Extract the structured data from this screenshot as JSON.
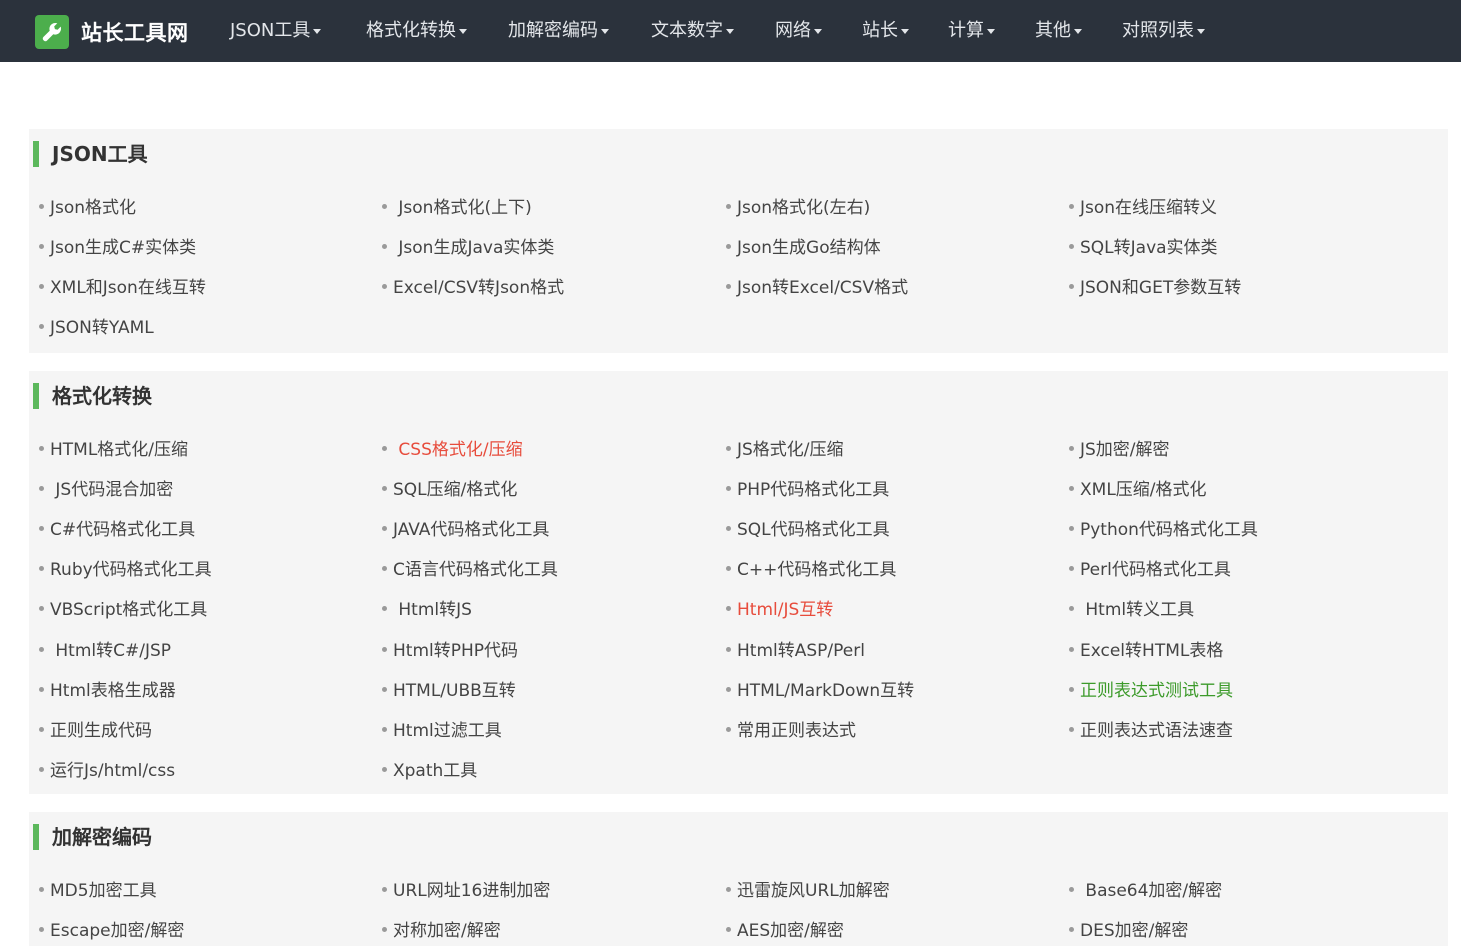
{
  "brand": {
    "name": "站长工具网"
  },
  "nav": [
    "JSON工具",
    "格式化转换",
    "加解密编码",
    "文本数字",
    "网络",
    "站长",
    "计算",
    "其他",
    "对照列表"
  ],
  "colors": {
    "nav_bg": "#2b323c",
    "accent": "#5cb85c",
    "panel_bg": "#f5f5f5",
    "link_red": "#e74c3c",
    "link_green": "#3c9a2a"
  },
  "sections": [
    {
      "title": "JSON工具",
      "items": [
        {
          "label": "Json格式化"
        },
        {
          "label": " Json格式化(上下)"
        },
        {
          "label": "Json格式化(左右)"
        },
        {
          "label": "Json在线压缩转义"
        },
        {
          "label": "Json生成C#实体类"
        },
        {
          "label": " Json生成Java实体类"
        },
        {
          "label": "Json生成Go结构体"
        },
        {
          "label": "SQL转Java实体类"
        },
        {
          "label": "XML和Json在线互转"
        },
        {
          "label": "Excel/CSV转Json格式"
        },
        {
          "label": "Json转Excel/CSV格式"
        },
        {
          "label": "JSON和GET参数互转"
        },
        {
          "label": "JSON转YAML"
        }
      ]
    },
    {
      "title": "格式化转换",
      "items": [
        {
          "label": "HTML格式化/压缩"
        },
        {
          "label": " CSS格式化/压缩",
          "highlight": "red"
        },
        {
          "label": "JS格式化/压缩"
        },
        {
          "label": "JS加密/解密"
        },
        {
          "label": " JS代码混合加密"
        },
        {
          "label": "SQL压缩/格式化"
        },
        {
          "label": "PHP代码格式化工具"
        },
        {
          "label": "XML压缩/格式化"
        },
        {
          "label": "C#代码格式化工具"
        },
        {
          "label": "JAVA代码格式化工具"
        },
        {
          "label": "SQL代码格式化工具"
        },
        {
          "label": "Python代码格式化工具"
        },
        {
          "label": "Ruby代码格式化工具"
        },
        {
          "label": "C语言代码格式化工具"
        },
        {
          "label": "C++代码格式化工具"
        },
        {
          "label": "Perl代码格式化工具"
        },
        {
          "label": "VBScript格式化工具"
        },
        {
          "label": " Html转JS"
        },
        {
          "label": "Html/JS互转",
          "highlight": "red"
        },
        {
          "label": " Html转义工具"
        },
        {
          "label": " Html转C#/JSP"
        },
        {
          "label": "Html转PHP代码"
        },
        {
          "label": "Html转ASP/Perl"
        },
        {
          "label": "Excel转HTML表格"
        },
        {
          "label": "Html表格生成器"
        },
        {
          "label": "HTML/UBB互转"
        },
        {
          "label": "HTML/MarkDown互转"
        },
        {
          "label": "正则表达式测试工具",
          "highlight": "green"
        },
        {
          "label": "正则生成代码"
        },
        {
          "label": "Html过滤工具"
        },
        {
          "label": "常用正则表达式"
        },
        {
          "label": "正则表达式语法速查"
        },
        {
          "label": "运行Js/html/css"
        },
        {
          "label": "Xpath工具"
        }
      ]
    },
    {
      "title": "加解密编码",
      "items": [
        {
          "label": "MD5加密工具"
        },
        {
          "label": "URL网址16进制加密"
        },
        {
          "label": "迅雷旋风URL加解密"
        },
        {
          "label": " Base64加密/解密"
        },
        {
          "label": "Escape加密/解密"
        },
        {
          "label": "对称加密/解密"
        },
        {
          "label": "AES加密/解密"
        },
        {
          "label": "DES加密/解密"
        }
      ]
    }
  ]
}
